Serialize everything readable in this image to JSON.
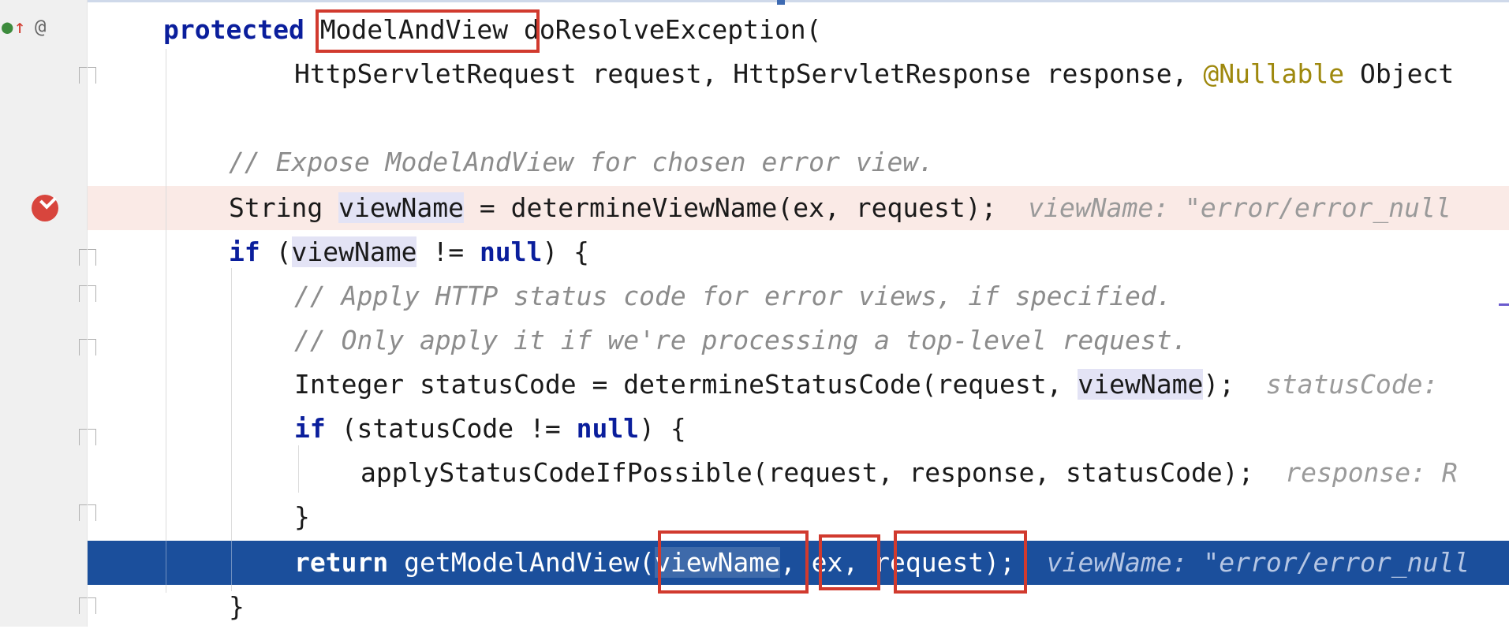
{
  "editor": {
    "line1": {
      "kw": "protected",
      "type": "ModelAndView",
      "rest": " doResolveException("
    },
    "line2": {
      "a": "HttpServletRequest request, HttpServletResponse response, ",
      "ann": "@Nullable",
      "b": " Object"
    },
    "line4": {
      "comment": "// Expose ModelAndView for chosen error view."
    },
    "line5": {
      "a": "String ",
      "var": "viewName",
      "b": " = determineViewName(ex, request);",
      "hint": "viewName: \"error/error_null"
    },
    "line6": {
      "kw": "if",
      "a": " (",
      "var": "viewName",
      "b": " != ",
      "nullkw": "null",
      "c": ") {"
    },
    "line7": {
      "comment": "// Apply HTTP status code for error views, if specified."
    },
    "line8": {
      "comment": "// Only apply it if we're processing a top-level request."
    },
    "line9": {
      "a": "Integer statusCode = determineStatusCode(request, ",
      "var": "viewName",
      "b": ");",
      "hint": "statusCode: "
    },
    "line10": {
      "kw": "if",
      "a": " (statusCode != ",
      "nullkw": "null",
      "b": ") {"
    },
    "line11": {
      "a": "applyStatusCodeIfPossible(request, response, statusCode);",
      "hint": "response: R"
    },
    "line12": {
      "a": "}"
    },
    "line13": {
      "kw": "return",
      "a": " getModelAndView(",
      "var": "viewName",
      "b": ", ex, request);",
      "hint": "viewName: \"error/error_null"
    },
    "line14": {
      "a": "}"
    }
  },
  "gutter": {
    "icons": [
      "implements-up-icon",
      "at-icon",
      "breakpoint-check-icon"
    ],
    "at_glyph": "@"
  },
  "colors": {
    "keyword": "#0a1e9c",
    "comment": "#8c8c8c",
    "annotation": "#9e880d",
    "highlight": "#1b4f9c",
    "redbox": "#d13a2e"
  }
}
